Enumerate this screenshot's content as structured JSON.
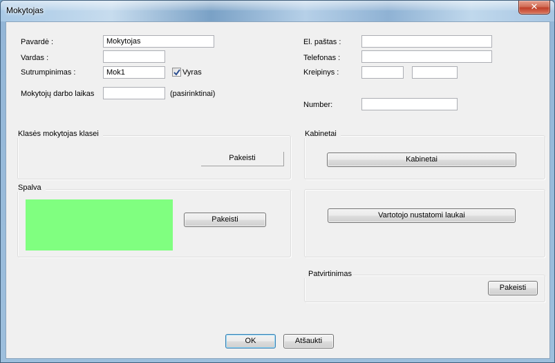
{
  "window": {
    "title": "Mokytojas",
    "close_label": "✕"
  },
  "form": {
    "surname_label": "Pavardė :",
    "surname_value": "Mokytojas",
    "name_label": "Vardas :",
    "name_value": "",
    "short_label": "Sutrumpinimas :",
    "short_value": "Mok1",
    "male_label": "Vyras",
    "male_checked": true,
    "worktime_label": "Mokytojų darbo laikas",
    "worktime_value": "",
    "worktime_hint": "(pasirinktinai)",
    "email_label": "El. paštas :",
    "email_value": "",
    "phone_label": "Telefonas :",
    "phone_value": "",
    "address_label": "Kreipinys :",
    "address_value_1": "",
    "address_value_2": "",
    "number_label": "Number:",
    "number_value": ""
  },
  "class_group": {
    "title": "Klasės mokytojas klasei",
    "button": "Pakeisti"
  },
  "color_group": {
    "title": "Spalva",
    "button": "Pakeisti",
    "color": "#80ff80"
  },
  "rooms_group": {
    "title": "Kabinetai",
    "button": "Kabinetai"
  },
  "custom_group": {
    "button": "Vartotojo nustatomi laukai"
  },
  "confirm_group": {
    "title": "Patvirtinimas",
    "button": "Pakeisti"
  },
  "footer": {
    "ok": "OK",
    "cancel": "Atšaukti"
  }
}
